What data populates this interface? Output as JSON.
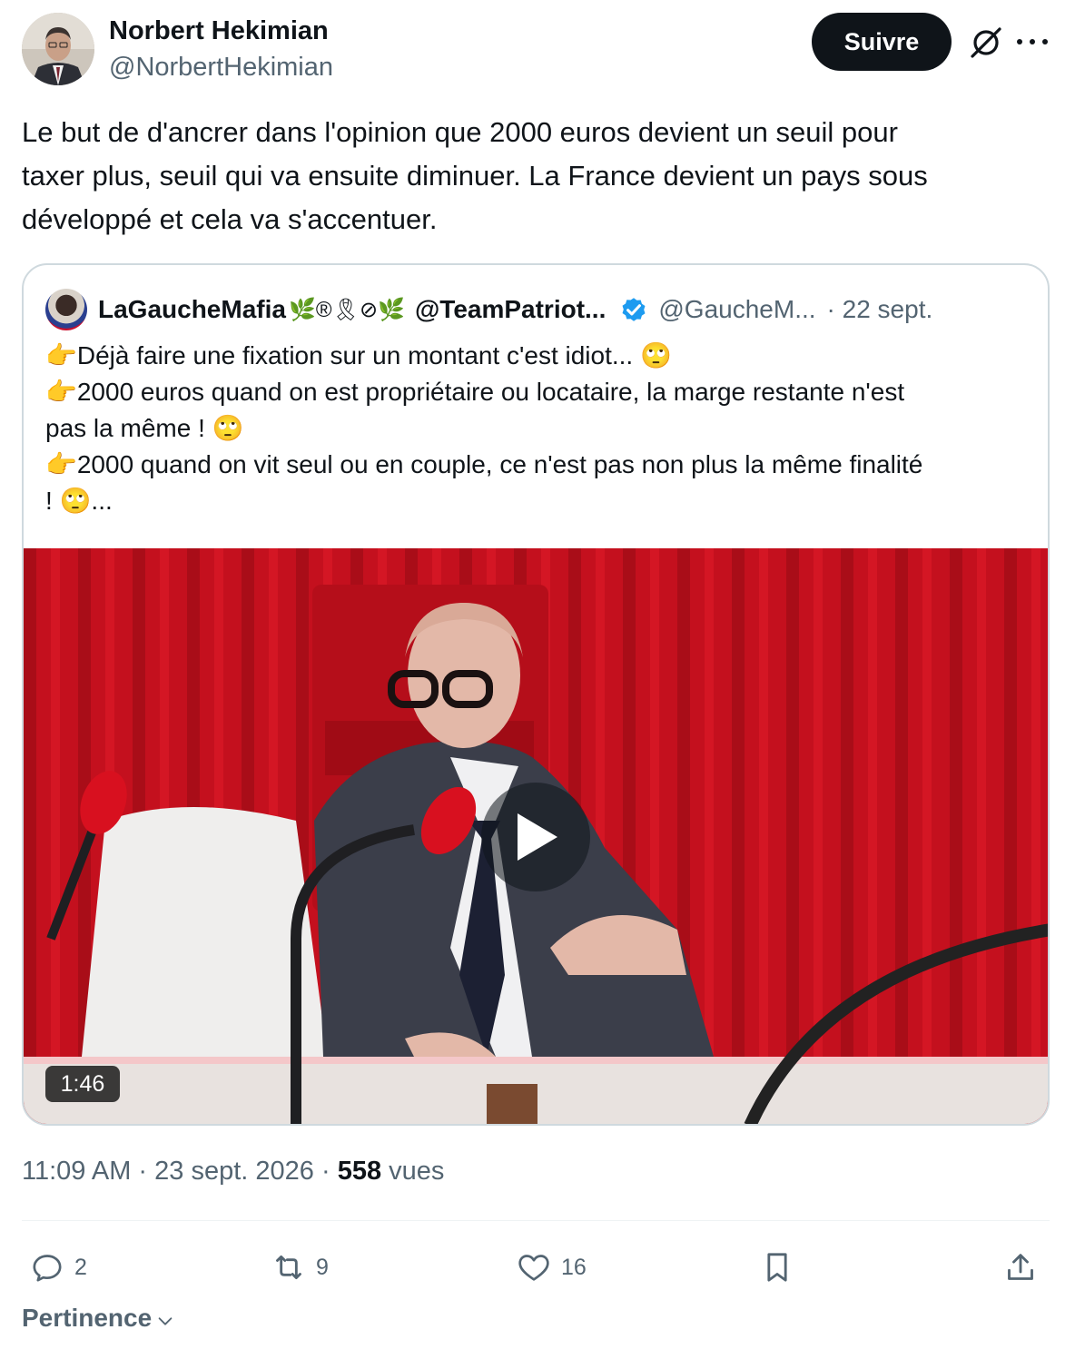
{
  "author": {
    "name": "Norbert Hekimian",
    "handle": "@NorbertHekimian",
    "follow_label": "Suivre"
  },
  "tweet": {
    "lines": [
      "Le but de d'ancrer dans l'opinion que 2000 euros devient un seuil pour",
      "taxer plus, seuil qui va ensuite diminuer. La France devient un pays sous",
      "développé et cela va s'accentuer."
    ]
  },
  "quote": {
    "name": "LaGaucheMafia",
    "emojis": "🌿®🎗⊘🌿",
    "team": "@TeamPatriot...",
    "handle": "@GaucheM...",
    "date": "· 22 sept.",
    "lines": [
      "👉Déjà faire une fixation sur un montant c'est idiot... 🙄",
      "👉2000 euros quand on est propriétaire ou locataire, la marge restante n'est",
      "pas la même ! 🙄",
      "👉2000 quand on vit seul ou en couple, ce n'est pas non plus la même finalité",
      "! 🙄..."
    ],
    "video": {
      "duration": "1:46"
    }
  },
  "meta": {
    "time_date": "11:09 AM · 23 sept. 2026 · ",
    "views_count": "558",
    "views_label": " vues"
  },
  "actions": {
    "replies": "2",
    "reposts": "9",
    "likes": "16"
  },
  "sort": {
    "label": "Pertinence"
  },
  "icons": [
    "grok-icon",
    "more-icon",
    "verified-icon",
    "play-icon",
    "reply-icon",
    "repost-icon",
    "like-icon",
    "bookmark-icon",
    "share-icon",
    "chevron-down-icon"
  ],
  "colors": {
    "text": "#0f1419",
    "secondary": "#536471",
    "verified": "#1d9bf0",
    "border": "#cfd9de",
    "follow_bg": "#0f1419",
    "video_red": "#c4101e"
  }
}
